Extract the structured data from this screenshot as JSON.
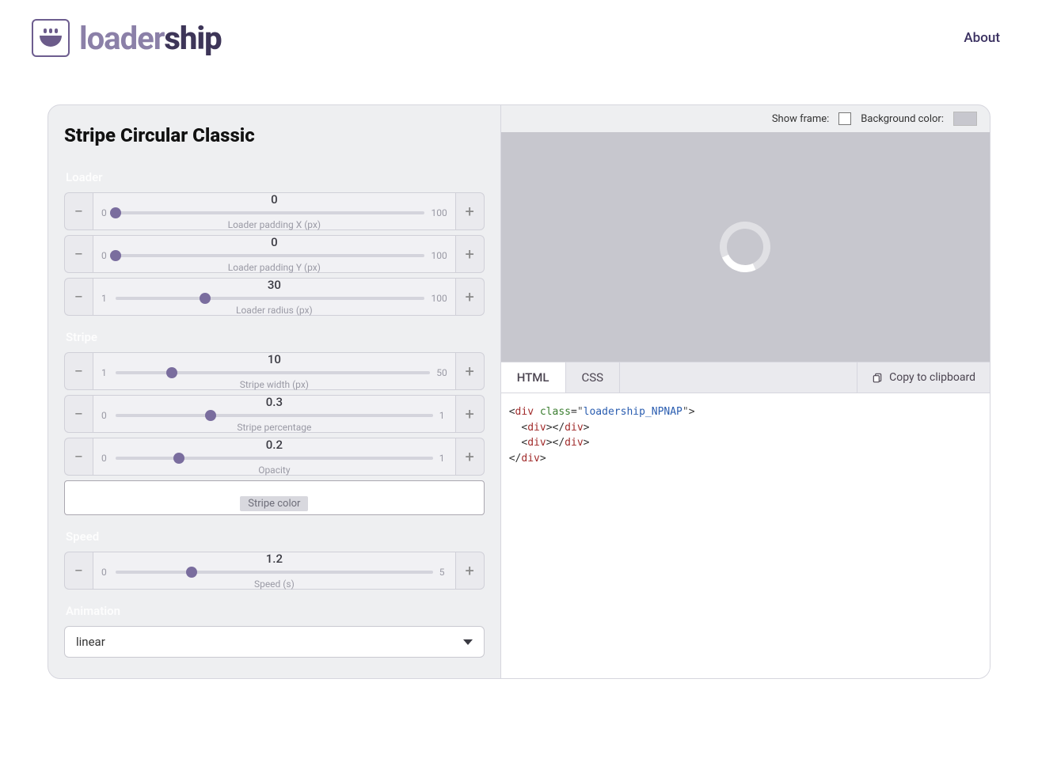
{
  "header": {
    "logo_light": "loader",
    "logo_bold": "ship",
    "about": "About"
  },
  "panel": {
    "title": "Stripe Circular Classic",
    "sections": {
      "loader": {
        "label": "Loader",
        "controls": [
          {
            "value": "0",
            "min": "0",
            "max": "100",
            "caption": "Loader padding X (px)",
            "pct": 0
          },
          {
            "value": "0",
            "min": "0",
            "max": "100",
            "caption": "Loader padding Y (px)",
            "pct": 0
          },
          {
            "value": "30",
            "min": "1",
            "max": "100",
            "caption": "Loader radius (px)",
            "pct": 29
          }
        ]
      },
      "stripe": {
        "label": "Stripe",
        "controls": [
          {
            "value": "10",
            "min": "1",
            "max": "50",
            "caption": "Stripe width (px)",
            "pct": 18
          },
          {
            "value": "0.3",
            "min": "0",
            "max": "1",
            "caption": "Stripe percentage",
            "pct": 30
          },
          {
            "value": "0.2",
            "min": "0",
            "max": "1",
            "caption": "Opacity",
            "pct": 20
          }
        ],
        "color_label": "Stripe color"
      },
      "speed": {
        "label": "Speed",
        "controls": [
          {
            "value": "1.2",
            "min": "0",
            "max": "5",
            "caption": "Speed (s)",
            "pct": 24
          }
        ]
      },
      "animation": {
        "label": "Animation",
        "selected": "linear"
      }
    }
  },
  "preview": {
    "show_frame_label": "Show frame:",
    "bg_color_label": "Background color:",
    "tabs": {
      "html": "HTML",
      "css": "CSS"
    },
    "copy_label": "Copy to clipboard",
    "code_class": "loadership_NPNAP"
  }
}
